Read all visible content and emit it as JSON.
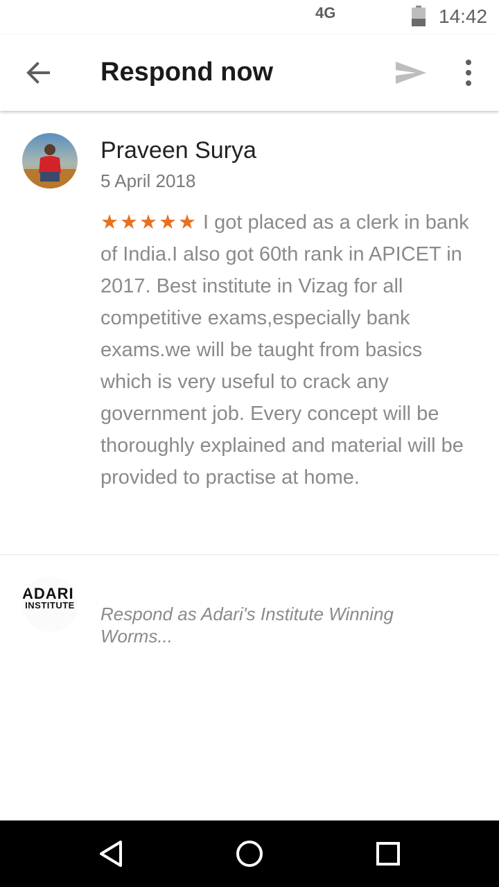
{
  "status_bar": {
    "network": "4G",
    "time": "14:42"
  },
  "toolbar": {
    "title": "Respond now"
  },
  "review": {
    "reviewer_name": "Praveen Surya",
    "date": "5 April 2018",
    "rating": 5,
    "stars": "★★★★★",
    "text": "I got placed as a clerk in bank of India.I also got 60th rank in APICET in 2017. Best institute in Vizag for all competitive exams,especially bank exams.we will be taught from basics which is very useful to crack any government job. Every  concept will be thoroughly explained and  material will be provided to practise at home."
  },
  "reply": {
    "logo_top": "ADARI'S",
    "logo_bottom": "INSTITUTE",
    "placeholder": "Respond as Adari's Institute Winning Worms..."
  },
  "colors": {
    "star": "#e8711f",
    "body_text": "#8a8a8a",
    "title_text": "#1b1b1b"
  }
}
